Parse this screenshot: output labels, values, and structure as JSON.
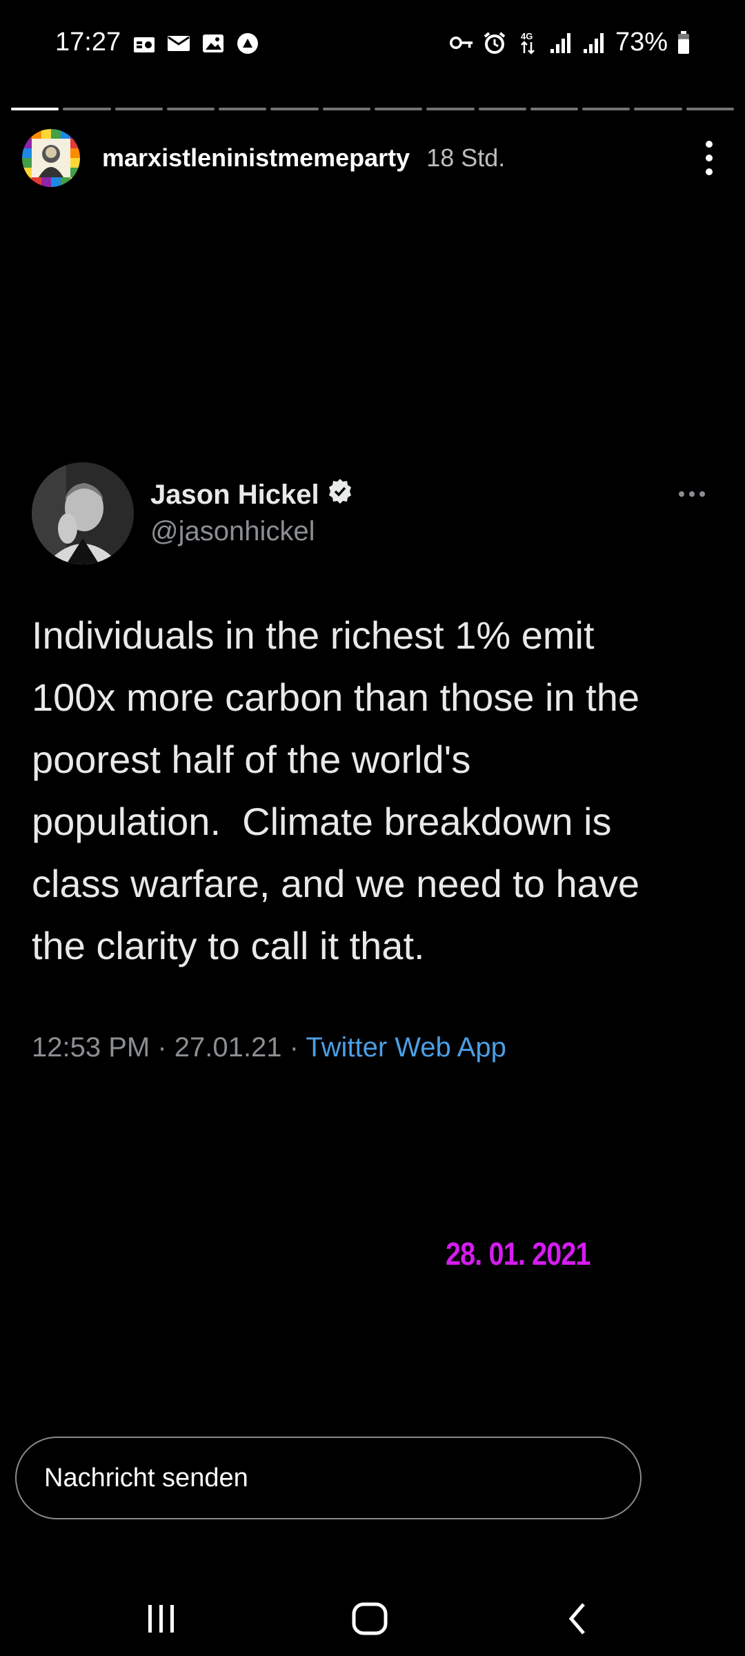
{
  "status_bar": {
    "time": "17:27",
    "left_icons": [
      "radio-icon",
      "mail-icon",
      "image-icon",
      "app-notification-icon"
    ],
    "right_icons": [
      "vpn-key-icon",
      "alarm-icon",
      "4g-data-icon",
      "signal-icon",
      "signal-icon"
    ],
    "battery_text": "73%",
    "battery_level": 0.73
  },
  "story": {
    "segments_count": 14,
    "current_segment": 0,
    "current_progress": 1.0,
    "username": "marxistleninistmemeparty",
    "time_ago": "18 Std.",
    "date_sticker": "28. 01. 2021"
  },
  "tweet": {
    "name": "Jason Hickel",
    "verified": true,
    "handle": "@jasonhickel",
    "lines": [
      "Individuals in the richest 1% emit",
      "100x more carbon than those in the",
      "poorest half of the world's",
      "population.  Climate breakdown is",
      "class warfare, and we need to have",
      "the clarity to call it that."
    ],
    "time": "12:53 PM",
    "date": "27.01.21",
    "separator": "·",
    "source": "Twitter Web App"
  },
  "message_input": {
    "placeholder": "Nachricht senden"
  },
  "colors": {
    "background": "#000000",
    "link_blue": "#4b9fe5",
    "sticker_magenta": "#d51cf0",
    "muted_gray": "#8b8f93"
  }
}
